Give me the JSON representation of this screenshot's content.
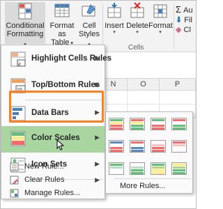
{
  "ribbon": {
    "conditional_formatting": {
      "line1": "Conditional",
      "line2": "Formatting"
    },
    "format_as_table": {
      "line1": "Format as",
      "line2": "Table"
    },
    "cell_styles": {
      "line1": "Cell",
      "line2": "Styles"
    },
    "insert": "Insert",
    "delete": "Delete",
    "format": "Format",
    "cells_group": "Cells",
    "autosum_partial": "Au",
    "fill_partial": "Fil",
    "clear_partial": "Cl"
  },
  "columns": [
    "N",
    "O",
    "P"
  ],
  "menu": {
    "items": [
      {
        "label": "Highlight Cells Rules",
        "icon": "highlight-cells-icon"
      },
      {
        "label": "Top/Bottom Rules",
        "icon": "top-bottom-icon"
      },
      {
        "label": "Data Bars",
        "icon": "data-bars-icon"
      },
      {
        "label": "Color Scales",
        "icon": "color-scales-icon"
      },
      {
        "label": "Icon Sets",
        "icon": "icon-sets-icon"
      }
    ],
    "small_items": [
      {
        "label": "New Rule...",
        "icon": "new-rule-icon"
      },
      {
        "label": "Clear Rules",
        "icon": "clear-rules-icon"
      },
      {
        "label": "Manage Rules...",
        "icon": "manage-rules-icon"
      }
    ]
  },
  "submenu": {
    "more_rules": "More Rules..."
  },
  "colors": {
    "highlight": "#a9d6a0",
    "outline": "#ff7f1f",
    "ribbon": "#f3f3f3"
  }
}
